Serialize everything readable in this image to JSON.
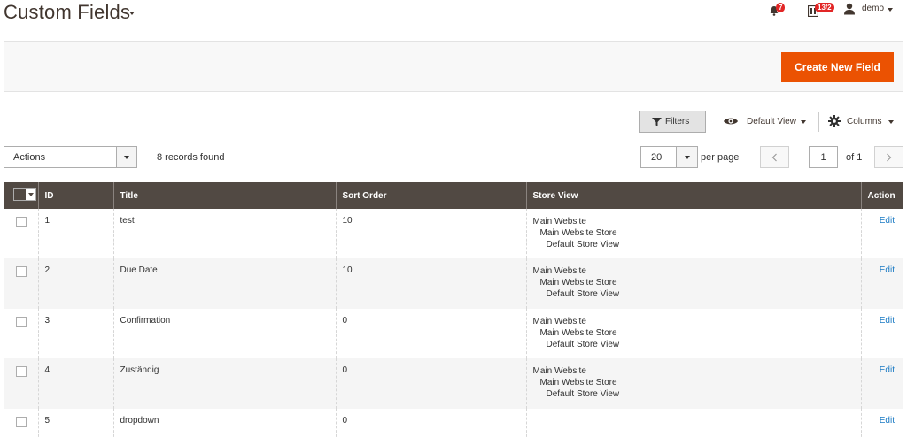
{
  "header": {
    "title": "Custom Fields",
    "notifications_count": "7",
    "system_messages_count": "13/2",
    "user_name": "demo"
  },
  "actionbar": {
    "create_button": "Create New Field"
  },
  "toolbar": {
    "filters_label": "Filters",
    "view_label": "Default View",
    "columns_label": "Columns",
    "actions_label": "Actions",
    "records_found": "8 records found",
    "per_page_value": "20",
    "per_page_label": "per page",
    "current_page": "1",
    "of_pages": "of 1"
  },
  "table": {
    "headers": {
      "id": "ID",
      "title": "Title",
      "sort_order": "Sort Order",
      "store_view": "Store View",
      "action": "Action"
    },
    "rows": [
      {
        "id": "1",
        "title": "test",
        "sort_order": "10",
        "store_view": [
          "Main Website",
          "Main Website Store",
          "Default Store View"
        ],
        "action": "Edit"
      },
      {
        "id": "2",
        "title": "Due Date",
        "sort_order": "10",
        "store_view": [
          "Main Website",
          "Main Website Store",
          "Default Store View"
        ],
        "action": "Edit"
      },
      {
        "id": "3",
        "title": "Confirmation",
        "sort_order": "0",
        "store_view": [
          "Main Website",
          "Main Website Store",
          "Default Store View"
        ],
        "action": "Edit"
      },
      {
        "id": "4",
        "title": "Zuständig",
        "sort_order": "0",
        "store_view": [
          "Main Website",
          "Main Website Store",
          "Default Store View"
        ],
        "action": "Edit"
      },
      {
        "id": "5",
        "title": "dropdown",
        "sort_order": "0",
        "store_view": [],
        "action": "Edit"
      }
    ]
  },
  "colors": {
    "accent": "#eb5202",
    "header_bg": "#514943",
    "link": "#1979c3",
    "badge": "#e22626"
  },
  "icons": [
    "bell-icon",
    "system-messages-icon",
    "user-icon",
    "filter-icon",
    "eye-icon",
    "gear-icon",
    "chevron-left-icon",
    "chevron-right-icon"
  ]
}
